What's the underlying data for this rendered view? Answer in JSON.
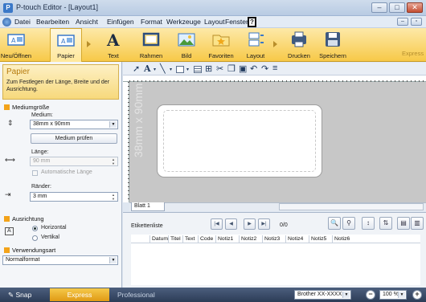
{
  "window": {
    "title": "P-touch Editor - [Layout1]"
  },
  "menu": [
    "Datei",
    "Bearbeiten",
    "Ansicht",
    "Einfügen",
    "Format",
    "Werkzeuge",
    "Layout",
    "Fenster",
    "?"
  ],
  "ribbon": {
    "buttons": [
      "Neu/Öffnen",
      "Papier",
      "Text",
      "Rahmen",
      "Bild",
      "Favoriten",
      "Layout",
      "Drucken",
      "Speichern"
    ],
    "express_tab": "Express"
  },
  "left_panel": {
    "title": "Papier",
    "description": "Zum Festlegen der Länge, Breite und der Ausrichtung.",
    "media_section": "Mediumgröße",
    "media_label": "Medium:",
    "media_value": "38mm x 90mm",
    "check_media_button": "Medium prüfen",
    "length_label": "Länge:",
    "length_value": "90 mm",
    "auto_length": "Automatische Länge",
    "margins_label": "Ränder:",
    "margins_value": "3 mm",
    "orientation_section": "Ausrichtung",
    "orientation_horizontal": "Horizontal",
    "orientation_vertical": "Vertikal",
    "usage_section": "Verwendungsart",
    "usage_value": "Normalformat"
  },
  "canvas": {
    "media_text": "38mm x 90mm",
    "sheet_tab": "Blatt 1"
  },
  "label_list": {
    "title": "Etikettenliste",
    "counter": "0/0",
    "columns": [
      "Datum",
      "Titel",
      "Text",
      "Code",
      "Notiz1",
      "Notiz2",
      "Notiz3",
      "Notiz4",
      "Notiz5",
      "Notiz6"
    ]
  },
  "status": {
    "snap": "Snap",
    "mode_express": "Express",
    "mode_professional": "Professional",
    "printer": "Brother XX-XXXX",
    "zoom": "100 %"
  }
}
